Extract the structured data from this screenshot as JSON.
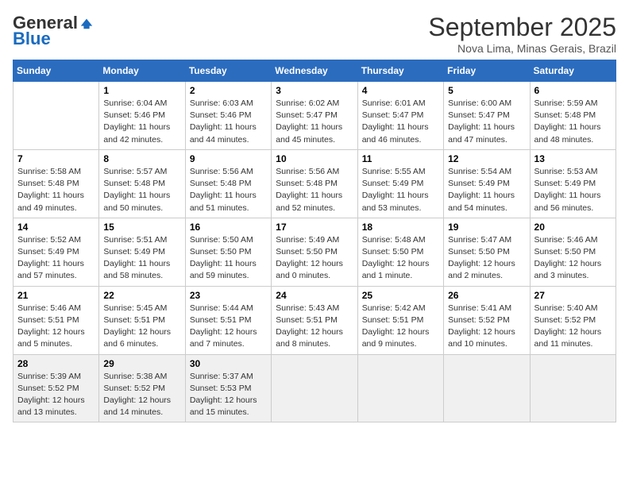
{
  "logo": {
    "general": "General",
    "blue": "Blue"
  },
  "title": "September 2025",
  "subtitle": "Nova Lima, Minas Gerais, Brazil",
  "days_header": [
    "Sunday",
    "Monday",
    "Tuesday",
    "Wednesday",
    "Thursday",
    "Friday",
    "Saturday"
  ],
  "weeks": [
    [
      {
        "day": "",
        "info": ""
      },
      {
        "day": "1",
        "info": "Sunrise: 6:04 AM\nSunset: 5:46 PM\nDaylight: 11 hours\nand 42 minutes."
      },
      {
        "day": "2",
        "info": "Sunrise: 6:03 AM\nSunset: 5:46 PM\nDaylight: 11 hours\nand 44 minutes."
      },
      {
        "day": "3",
        "info": "Sunrise: 6:02 AM\nSunset: 5:47 PM\nDaylight: 11 hours\nand 45 minutes."
      },
      {
        "day": "4",
        "info": "Sunrise: 6:01 AM\nSunset: 5:47 PM\nDaylight: 11 hours\nand 46 minutes."
      },
      {
        "day": "5",
        "info": "Sunrise: 6:00 AM\nSunset: 5:47 PM\nDaylight: 11 hours\nand 47 minutes."
      },
      {
        "day": "6",
        "info": "Sunrise: 5:59 AM\nSunset: 5:48 PM\nDaylight: 11 hours\nand 48 minutes."
      }
    ],
    [
      {
        "day": "7",
        "info": "Sunrise: 5:58 AM\nSunset: 5:48 PM\nDaylight: 11 hours\nand 49 minutes."
      },
      {
        "day": "8",
        "info": "Sunrise: 5:57 AM\nSunset: 5:48 PM\nDaylight: 11 hours\nand 50 minutes."
      },
      {
        "day": "9",
        "info": "Sunrise: 5:56 AM\nSunset: 5:48 PM\nDaylight: 11 hours\nand 51 minutes."
      },
      {
        "day": "10",
        "info": "Sunrise: 5:56 AM\nSunset: 5:48 PM\nDaylight: 11 hours\nand 52 minutes."
      },
      {
        "day": "11",
        "info": "Sunrise: 5:55 AM\nSunset: 5:49 PM\nDaylight: 11 hours\nand 53 minutes."
      },
      {
        "day": "12",
        "info": "Sunrise: 5:54 AM\nSunset: 5:49 PM\nDaylight: 11 hours\nand 54 minutes."
      },
      {
        "day": "13",
        "info": "Sunrise: 5:53 AM\nSunset: 5:49 PM\nDaylight: 11 hours\nand 56 minutes."
      }
    ],
    [
      {
        "day": "14",
        "info": "Sunrise: 5:52 AM\nSunset: 5:49 PM\nDaylight: 11 hours\nand 57 minutes."
      },
      {
        "day": "15",
        "info": "Sunrise: 5:51 AM\nSunset: 5:49 PM\nDaylight: 11 hours\nand 58 minutes."
      },
      {
        "day": "16",
        "info": "Sunrise: 5:50 AM\nSunset: 5:50 PM\nDaylight: 11 hours\nand 59 minutes."
      },
      {
        "day": "17",
        "info": "Sunrise: 5:49 AM\nSunset: 5:50 PM\nDaylight: 12 hours\nand 0 minutes."
      },
      {
        "day": "18",
        "info": "Sunrise: 5:48 AM\nSunset: 5:50 PM\nDaylight: 12 hours\nand 1 minute."
      },
      {
        "day": "19",
        "info": "Sunrise: 5:47 AM\nSunset: 5:50 PM\nDaylight: 12 hours\nand 2 minutes."
      },
      {
        "day": "20",
        "info": "Sunrise: 5:46 AM\nSunset: 5:50 PM\nDaylight: 12 hours\nand 3 minutes."
      }
    ],
    [
      {
        "day": "21",
        "info": "Sunrise: 5:46 AM\nSunset: 5:51 PM\nDaylight: 12 hours\nand 5 minutes."
      },
      {
        "day": "22",
        "info": "Sunrise: 5:45 AM\nSunset: 5:51 PM\nDaylight: 12 hours\nand 6 minutes."
      },
      {
        "day": "23",
        "info": "Sunrise: 5:44 AM\nSunset: 5:51 PM\nDaylight: 12 hours\nand 7 minutes."
      },
      {
        "day": "24",
        "info": "Sunrise: 5:43 AM\nSunset: 5:51 PM\nDaylight: 12 hours\nand 8 minutes."
      },
      {
        "day": "25",
        "info": "Sunrise: 5:42 AM\nSunset: 5:51 PM\nDaylight: 12 hours\nand 9 minutes."
      },
      {
        "day": "26",
        "info": "Sunrise: 5:41 AM\nSunset: 5:52 PM\nDaylight: 12 hours\nand 10 minutes."
      },
      {
        "day": "27",
        "info": "Sunrise: 5:40 AM\nSunset: 5:52 PM\nDaylight: 12 hours\nand 11 minutes."
      }
    ],
    [
      {
        "day": "28",
        "info": "Sunrise: 5:39 AM\nSunset: 5:52 PM\nDaylight: 12 hours\nand 13 minutes."
      },
      {
        "day": "29",
        "info": "Sunrise: 5:38 AM\nSunset: 5:52 PM\nDaylight: 12 hours\nand 14 minutes."
      },
      {
        "day": "30",
        "info": "Sunrise: 5:37 AM\nSunset: 5:53 PM\nDaylight: 12 hours\nand 15 minutes."
      },
      {
        "day": "",
        "info": ""
      },
      {
        "day": "",
        "info": ""
      },
      {
        "day": "",
        "info": ""
      },
      {
        "day": "",
        "info": ""
      }
    ]
  ]
}
